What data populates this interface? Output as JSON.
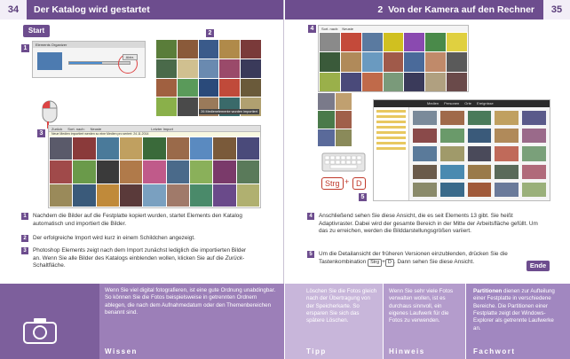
{
  "left": {
    "page_number": "34",
    "title": "Der Katalog wird gestartet",
    "start_label": "Start",
    "badges": [
      "1",
      "2",
      "3"
    ],
    "import_dialog": {
      "title": "Elements Organizer",
      "button": "Abbr."
    },
    "import_notice": "26 Medienelemente wurden importiert",
    "organizer": {
      "back": "Zurück",
      "sort_label": "Sort. nach:",
      "sort_value": "Neuste",
      "title": "Letzter Import",
      "info": "Neue Medien importiert werden so eine Medien pro seriert: 24.11.2014"
    },
    "steps": [
      {
        "n": "1",
        "text": "Nachdem die Bilder auf die Festplatte kopiert wurden, startet Elements den Katalog automatisch und importiert die Bilder."
      },
      {
        "n": "2",
        "text": "Der erfolgreiche Import wird kurz in einem Schildchen angezeigt."
      },
      {
        "n": "3",
        "text_before": "Photoshop Elements zeigt nach dem Import zunächst lediglich die importierten Bilder an. Wenn Sie alle Bilder des Katalogs einblenden wollen, klicken Sie auf die ",
        "text_italic": "Zurück",
        "text_after": "-Schaltfläche."
      }
    ],
    "wissen": {
      "text": "Wenn Sie viel digital fotografieren, ist eine gute Ordnung unabdingbar. So können Sie die Fotos beispielsweise in getrennten Ordnern ablegen, die nach dem Aufnahmedatum oder den Themenbereichen benannt sind.",
      "label": "Wissen"
    }
  },
  "right": {
    "page_number": "35",
    "title": "Von der Kamera auf den Rechner",
    "chapter_number": "2",
    "badges": [
      "4",
      "5"
    ],
    "sort_label": "Sort. nach:",
    "sort_value": "Neuste",
    "explorer_tabs": [
      "Medien",
      "Personen",
      "Orte",
      "Ereignisse"
    ],
    "keys": {
      "strg": "Strg",
      "plus": "+",
      "d": "D"
    },
    "steps": [
      {
        "n": "4",
        "text": "Anschließend sehen Sie diese Ansicht, die es seit Elements 13 gibt. Sie heißt Adaptivraster. Dabei wird der gesamte Bereich in der Mitte der Arbeitsfläche gefüllt. Um das zu erreichen, werden die Bilddarstellungsgrößen variiert."
      },
      {
        "n": "5",
        "text_before": "Um die Detailansicht der früheren Versionen einzublenden, drücken Sie die Tastenkombination ",
        "key1": "Strg",
        "key_plus": "+",
        "key2": "D",
        "text_after": ". Dann sehen Sie diese Ansicht."
      }
    ],
    "ende_label": "Ende",
    "tipp": {
      "text": "Löschen Sie die Fotos gleich nach der Übertragung von der Speicherkarte. So ersparen Sie sich das spätere Löschen.",
      "label": "Tipp"
    },
    "hinweis": {
      "text": "Wenn Sie sehr viele Fotos verwalten wollen, ist es durchaus sinnvoll, ein eigenes Laufwerk für die Fotos zu verwenden.",
      "label": "Hinweis"
    },
    "fachwort": {
      "term": "Partitionen",
      "text": " dienen zur Aufteilung einer Festplatte in verschiedene Bereiche. Die Partitionen einer Festplatte zeigt der Windows-Explorer als getrennte Laufwerke an.",
      "label": "Fachwort"
    }
  },
  "colors": {
    "accent": "#6d4d8e",
    "band": "#9c7fb8",
    "tipp": "#c8b6da",
    "hinweis": "#b49ccc",
    "fachwort": "#a187c0",
    "keys": "#c0392b"
  }
}
